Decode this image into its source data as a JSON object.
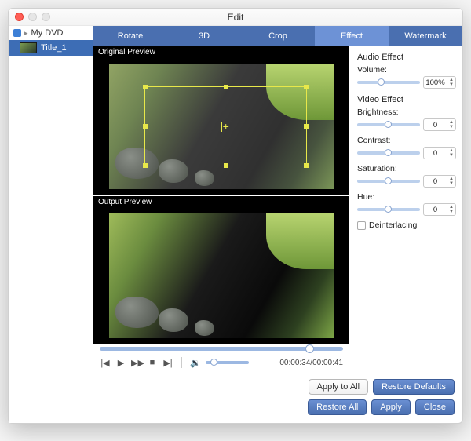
{
  "window": {
    "title": "Edit"
  },
  "sidebar": {
    "root": "My DVD",
    "items": [
      {
        "label": "Title_1"
      }
    ]
  },
  "tabs": [
    {
      "label": "Rotate",
      "active": false
    },
    {
      "label": "3D",
      "active": false
    },
    {
      "label": "Crop",
      "active": false
    },
    {
      "label": "Effect",
      "active": true
    },
    {
      "label": "Watermark",
      "active": false
    }
  ],
  "preview": {
    "original_label": "Original Preview",
    "output_label": "Output Preview",
    "timecode": "00:00:34/00:00:41"
  },
  "effects": {
    "audio_title": "Audio Effect",
    "volume_label": "Volume:",
    "volume_value": "100%",
    "video_title": "Video Effect",
    "brightness_label": "Brightness:",
    "brightness_value": "0",
    "contrast_label": "Contrast:",
    "contrast_value": "0",
    "saturation_label": "Saturation:",
    "saturation_value": "0",
    "hue_label": "Hue:",
    "hue_value": "0",
    "deinterlacing_label": "Deinterlacing"
  },
  "buttons": {
    "apply_all": "Apply to All",
    "restore_defaults": "Restore Defaults",
    "restore_all": "Restore All",
    "apply": "Apply",
    "close": "Close"
  }
}
